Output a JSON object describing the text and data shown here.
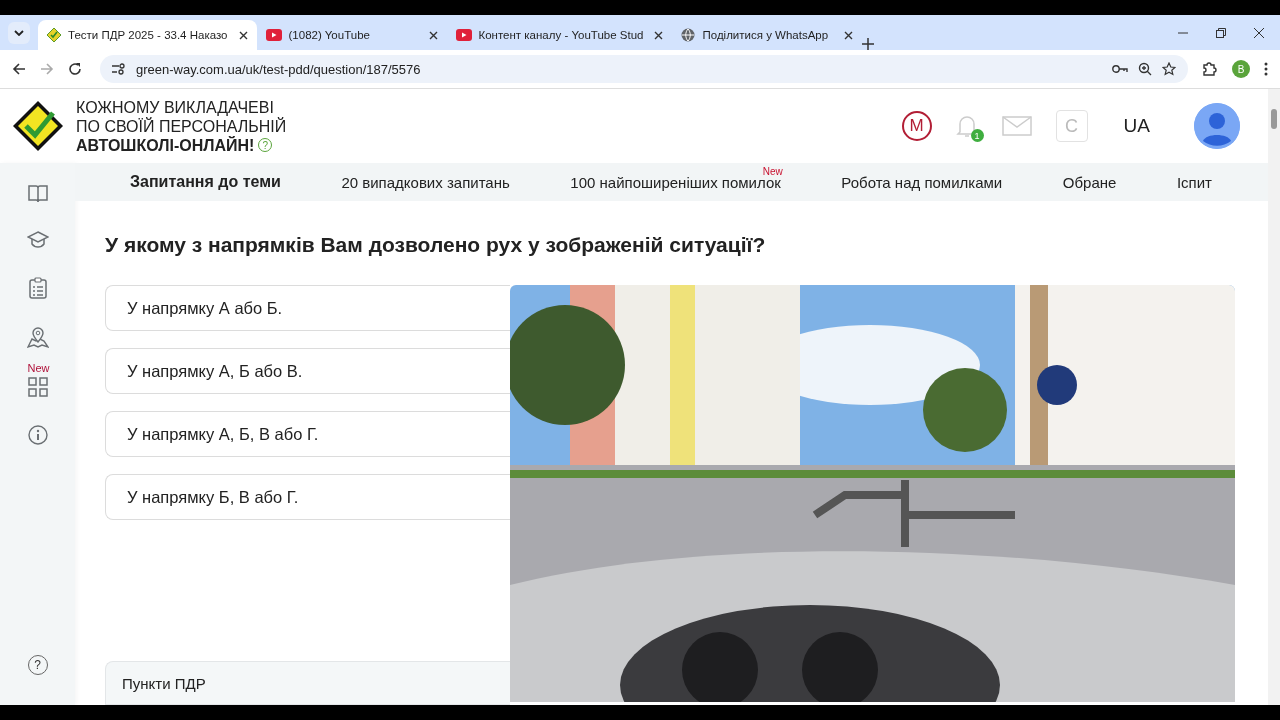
{
  "browser": {
    "tabs": [
      {
        "title": "Тести ПДР 2025 - 33.4 Наказо",
        "selected": true,
        "kind": "site"
      },
      {
        "title": "(1082) YouTube",
        "selected": false,
        "kind": "video"
      },
      {
        "title": "Контент каналу - YouTube Stud",
        "selected": false,
        "kind": "video"
      },
      {
        "title": "Поділитися у WhatsApp",
        "selected": false,
        "kind": "web"
      }
    ],
    "url": "green-way.com.ua/uk/test-pdd/question/187/5576",
    "profile": "B"
  },
  "header": {
    "logo_lines": [
      "КОЖНОМУ ВИКЛАДАЧЕВІ",
      "ПО СВОЇЙ ПЕРСОНАЛЬНІЙ",
      "АВТОШКОЛІ-ОНЛАЙН!"
    ],
    "help": "?",
    "m_badge": "М",
    "notifications": "1",
    "c_button": "С",
    "language": "UA"
  },
  "nav": [
    {
      "label": "Запитання до теми",
      "selected": true
    },
    {
      "label": "20 випадкових запитань",
      "selected": false
    },
    {
      "label": "100 найпоширеніших помилок",
      "selected": false,
      "badge": "New"
    },
    {
      "label": "Робота над помилками",
      "selected": false
    },
    {
      "label": "Обране",
      "selected": false
    },
    {
      "label": "Іспит",
      "selected": false
    }
  ],
  "sidebar": {
    "items": [
      {
        "kind": "book"
      },
      {
        "kind": "graduation"
      },
      {
        "kind": "checklist"
      },
      {
        "kind": "map"
      },
      {
        "kind": "grid",
        "badge": "New"
      },
      {
        "kind": "info"
      }
    ],
    "help": "?"
  },
  "question": "У якому з напрямків Вам дозволено рух у зображеній ситуації?",
  "answers": [
    "У напрямку А або Б.",
    "У напрямку А, Б або В.",
    "У напрямку А, Б, В або Г.",
    "У напрямку Б, В або Г."
  ],
  "footer_panel": "Пункти ПДР"
}
